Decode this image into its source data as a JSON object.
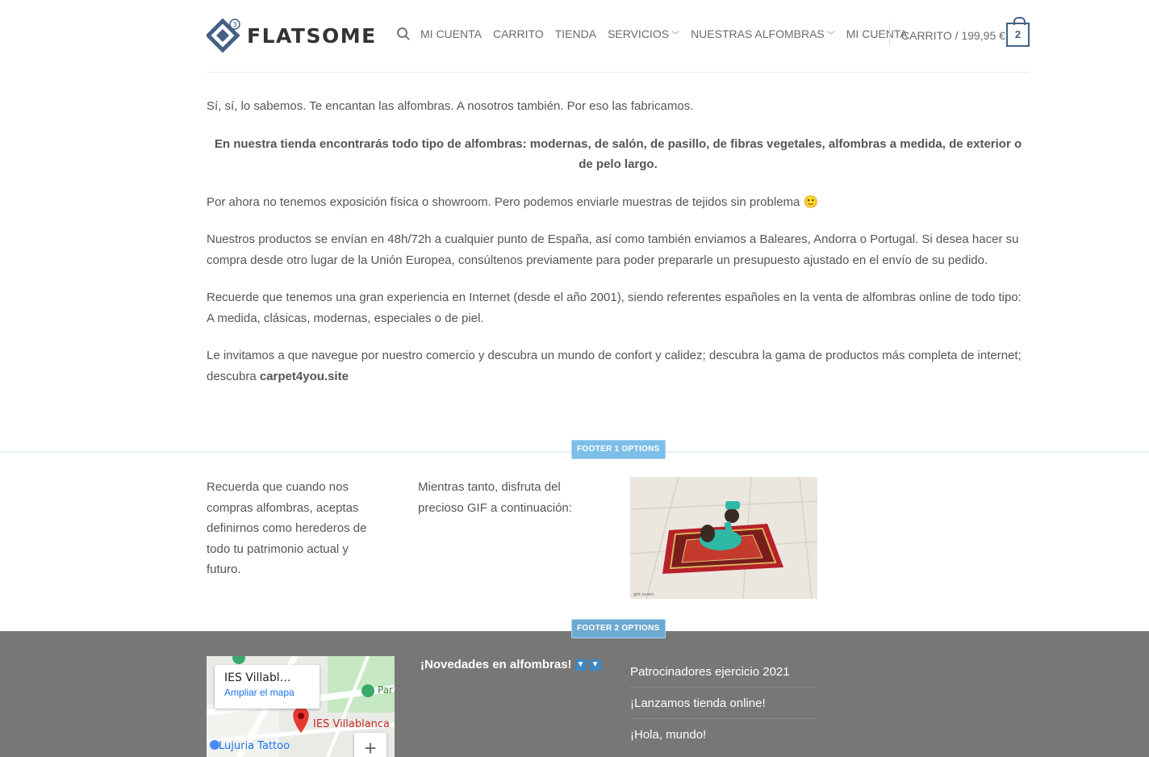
{
  "header": {
    "logo_text": "FLATSOME",
    "logo_badge": "3",
    "nav": [
      {
        "label": "MI CUENTA"
      },
      {
        "label": "CARRITO"
      },
      {
        "label": "TIENDA"
      },
      {
        "label": "SERVICIOS"
      },
      {
        "label": "NUESTRAS ALFOMBRAS"
      },
      {
        "label": "MI CUENTA"
      }
    ],
    "cart_label": "CARRITO / 199,95 €",
    "cart_count": "2"
  },
  "content": {
    "p1": "Sí, sí, lo sabemos. Te encantan las alfombras. A nosotros también. Por eso las fabricamos.",
    "p2": "En nuestra tienda encontrarás todo tipo de alfombras: modernas, de salón, de pasillo, de fibras vegetales, alfombras a medida, de exterior o de pelo largo.",
    "p3": "Por ahora no tenemos exposición física o showroom. Pero podemos enviarle muestras de tejidos sin problema 🙂",
    "p4": "Nuestros productos se envían en 48h/72h a cualquier punto de España, así como también enviamos a Baleares, Andorra o Portugal. Si desea hacer su compra desde otro lugar de la Unión Europea, consúltenos previamente para poder prepararle un presupuesto ajustado en el envío de su pedido.",
    "p5": "Recuerde que tenemos una gran experiencia en Internet (desde el año 2001), siendo referentes españoles en la venta de alfombras online de todo tipo: A medida, clásicas, modernas, especiales o de piel.",
    "p6_text": "Le invitamos a que navegue por nuestro comercio y descubra un mundo de confort y calidez; descubra la gama de productos más completa de internet; descubra ",
    "p6_link": "carpet4you.site"
  },
  "footer1": {
    "badge": "FOOTER 1 OPTIONS",
    "col1": "Recuerda que cuando nos compras alfombras, aceptas definirnos como herederos de todo tu patrimonio actual y futuro.",
    "col2": "Mientras tanto, disfruta del precioso GIF a continuación:",
    "gif_caption": "gifs lovers"
  },
  "footer2": {
    "badge": "FOOTER 2 OPTIONS",
    "map": {
      "title": "IES Villabl…",
      "link": "Ampliar el mapa",
      "pin_label": "IES Villablanca",
      "street_label": "Lujuria Tattoo",
      "park_label": "Par de",
      "zoom_label": "+"
    },
    "news_title": "¡Novedades en alfombras!",
    "posts": [
      {
        "label": "Patrocinadores ejercicio 2021"
      },
      {
        "label": "¡Lanzamos tienda online!"
      },
      {
        "label": "¡Hola, mundo!"
      }
    ]
  },
  "colors": {
    "brand": "#446084",
    "footer2_bg": "#777777",
    "badge": "#7dbfe8"
  }
}
